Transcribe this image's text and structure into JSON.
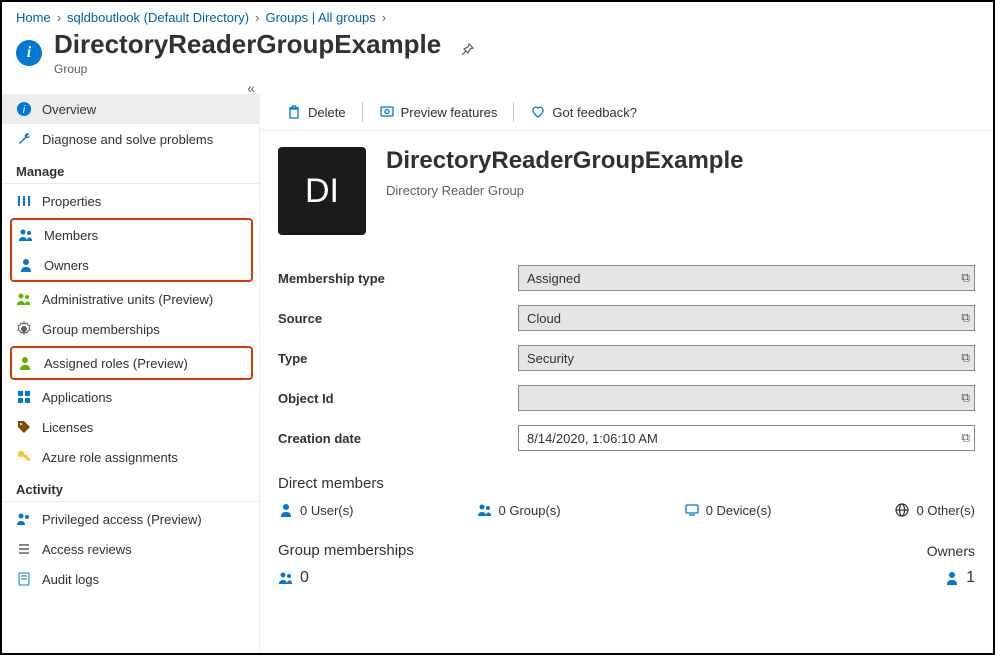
{
  "breadcrumb": [
    {
      "label": "Home"
    },
    {
      "label": "sqldboutlook (Default Directory)"
    },
    {
      "label": "Groups | All groups"
    }
  ],
  "header": {
    "title": "DirectoryReaderGroupExample",
    "subtitle": "Group"
  },
  "sidebar": {
    "items_top": [
      {
        "label": "Overview",
        "icon": "info"
      },
      {
        "label": "Diagnose and solve problems",
        "icon": "wrench"
      }
    ],
    "section_manage": "Manage",
    "items_manage": [
      {
        "label": "Properties",
        "icon": "sliders"
      },
      {
        "label": "Members",
        "icon": "people-blue"
      },
      {
        "label": "Owners",
        "icon": "person-blue"
      },
      {
        "label": "Administrative units (Preview)",
        "icon": "people-green"
      },
      {
        "label": "Group memberships",
        "icon": "gear-people"
      },
      {
        "label": "Assigned roles (Preview)",
        "icon": "person-green"
      },
      {
        "label": "Applications",
        "icon": "grid"
      },
      {
        "label": "Licenses",
        "icon": "tag"
      },
      {
        "label": "Azure role assignments",
        "icon": "key"
      }
    ],
    "section_activity": "Activity",
    "items_activity": [
      {
        "label": "Privileged access (Preview)",
        "icon": "people-blue"
      },
      {
        "label": "Access reviews",
        "icon": "list"
      },
      {
        "label": "Audit logs",
        "icon": "log"
      }
    ]
  },
  "toolbar": {
    "delete": "Delete",
    "preview": "Preview features",
    "feedback": "Got feedback?"
  },
  "object": {
    "tile_initials": "DI",
    "title": "DirectoryReaderGroupExample",
    "subtitle": "Directory Reader Group"
  },
  "props": {
    "membership_type": {
      "label": "Membership type",
      "value": "Assigned"
    },
    "source": {
      "label": "Source",
      "value": "Cloud"
    },
    "type": {
      "label": "Type",
      "value": "Security"
    },
    "object_id": {
      "label": "Object Id",
      "value": ""
    },
    "creation_date": {
      "label": "Creation date",
      "value": "8/14/2020, 1:06:10 AM"
    }
  },
  "direct_members": {
    "title": "Direct members",
    "users": "0 User(s)",
    "groups": "0 Group(s)",
    "devices": "0 Device(s)",
    "others": "0 Other(s)"
  },
  "group_memberships": {
    "title": "Group memberships",
    "count": "0",
    "owners_label": "Owners",
    "owners_count": "1"
  }
}
